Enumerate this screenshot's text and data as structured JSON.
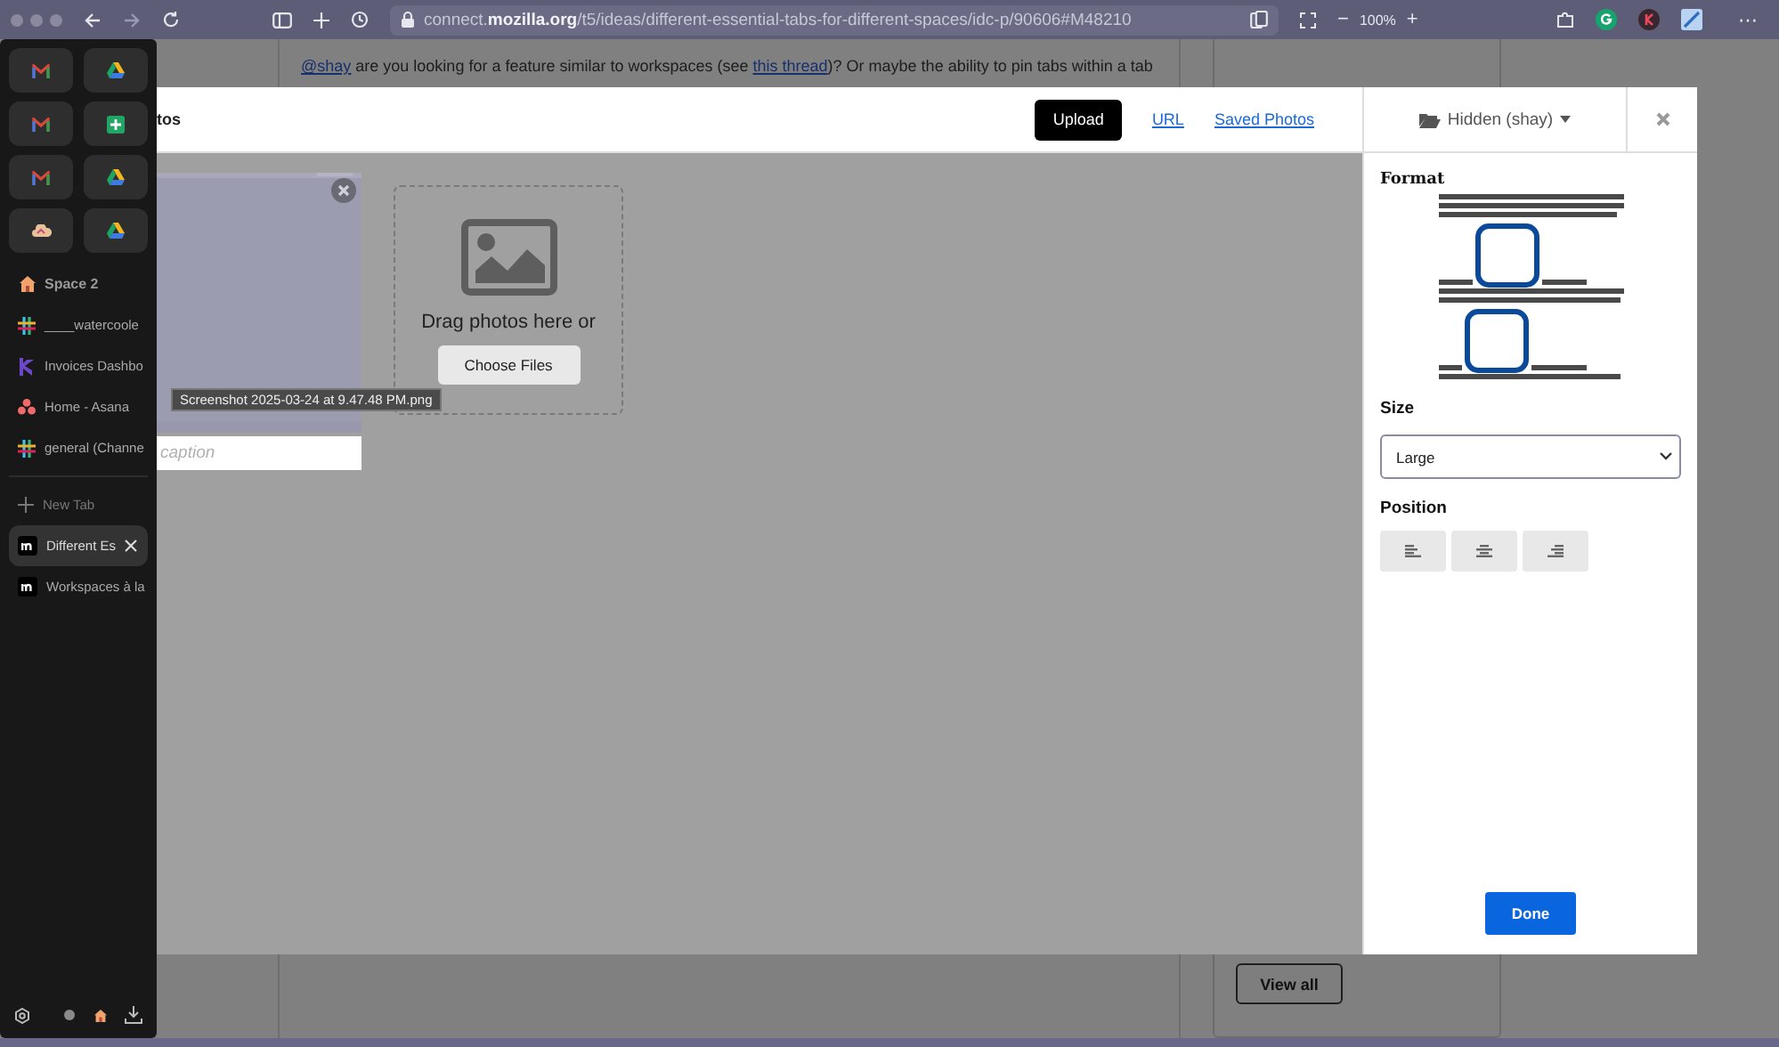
{
  "toolbar": {
    "url": "connect.**mozilla.org**/t5/ideas/different-essential-tabs-for-different-spaces/idc-p/90606#M48210",
    "zoom_out": "−",
    "zoom": "100%",
    "zoom_in": "+",
    "menu": "⋯"
  },
  "page": {
    "comment": [
      {
        "kind": "link",
        "text": "@shay"
      },
      {
        "kind": "text",
        "text": " are you looking for a feature similar to workspaces (see "
      },
      {
        "kind": "link",
        "text": "this thread"
      },
      {
        "kind": "text",
        "text": ")? Or maybe the ability to pin tabs within a tab"
      }
    ],
    "view_all": "View all"
  },
  "sidebar": {
    "pinned": [
      {
        "kind": "gmail"
      },
      {
        "kind": "drive"
      },
      {
        "kind": "gmail"
      },
      {
        "kind": "sheets"
      },
      {
        "kind": "gmail"
      },
      {
        "kind": "drive"
      },
      {
        "kind": "cloud"
      },
      {
        "kind": "drive"
      }
    ],
    "space": "Space 2",
    "tabs": [
      {
        "kind": "slack",
        "label": "____watercoole",
        "selected": false
      },
      {
        "kind": "invoice",
        "label": "Invoices Dashbo",
        "selected": false
      },
      {
        "kind": "asana",
        "label": "Home - Asana",
        "selected": false
      },
      {
        "kind": "slack",
        "label": "general (Channe",
        "selected": false
      }
    ],
    "new_tab": "New Tab",
    "open_tabs": [
      {
        "kind": "mozilla",
        "label": "Different Es",
        "selected": true
      },
      {
        "kind": "mozilla",
        "label": "Workspaces à la",
        "selected": false
      }
    ]
  },
  "modal": {
    "title": "tos",
    "tabs": [
      {
        "label": "Upload",
        "selected": true
      },
      {
        "label": "URL",
        "selected": false
      },
      {
        "label": "Saved Photos",
        "selected": false
      }
    ],
    "album": "Hidden (shay)",
    "thumbnail": {
      "tooltip": "Screenshot 2025-03-24 at 9.47.48 PM.png",
      "caption_placeholder": "caption"
    },
    "dropzone": {
      "text": "Drag photos here or",
      "button": "Choose Files"
    },
    "format_label": "Format",
    "size_label": "Size",
    "size": "Large",
    "position_label": "Position",
    "positions": [
      {
        "kind": "left"
      },
      {
        "kind": "center"
      },
      {
        "kind": "right"
      }
    ],
    "done": "Done"
  }
}
